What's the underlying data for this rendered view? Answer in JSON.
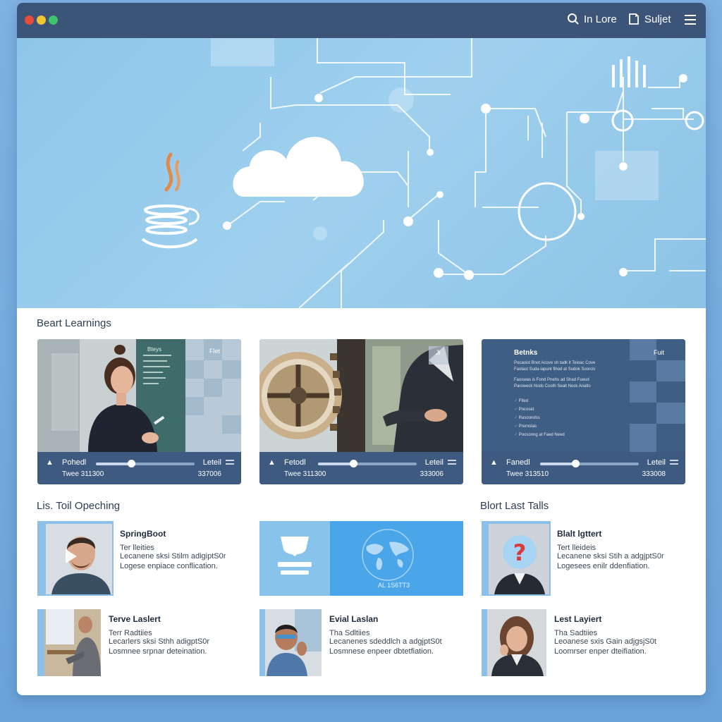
{
  "window": {
    "dots": [
      "close",
      "minimize",
      "maximize"
    ]
  },
  "titlebar": {
    "search_label": "In Lore",
    "subject_label": "Suljet",
    "search_icon": "search-icon",
    "subject_icon": "bookmark-icon",
    "menu_icon": "hamburger-menu-icon"
  },
  "hero": {
    "graphics": [
      "java-logo-icon",
      "cloud-icon",
      "circuit-lines"
    ]
  },
  "sections": {
    "learnings_title": "Beart Learnings",
    "opeching_title": "Lis. Toil Opeching",
    "last_talls_title": "Blort Last Talls"
  },
  "video_cards": [
    {
      "panel_heading": "Bteys",
      "panel_corner": "Flet",
      "control_label": "Pohedl",
      "control_sub": "Twee 311300",
      "level_label": "Leteil",
      "time_label": "337006",
      "progress": 0.36
    },
    {
      "panel_heading": "",
      "panel_corner": "Ji",
      "control_label": "Fetodl",
      "control_sub": "Twee 311300",
      "level_label": "Leteil",
      "time_label": "333006",
      "progress": 0.36
    },
    {
      "panel_heading": "Betnks",
      "panel_corner": "Fuit",
      "panel_lines": [
        "Pocaoist Bnot Acove sh tadk it Teioac Cove",
        "Faotast Suda iapunt fihod at Sudok Soorcis",
        "Faoswas is Fond Pnehs ad Shad Fueud",
        "Paroweck Nods Cooth Sealt Nock Anatlo"
      ],
      "panel_checks": [
        "Flted",
        "Pocoset",
        "Rasoondss",
        "Premolas",
        "Poosonng at Faed Need"
      ],
      "control_label": "Fanedl",
      "control_sub": "Twee 313510",
      "level_label": "Leteil",
      "time_label": "333008",
      "progress": 0.36
    }
  ],
  "courses": [
    {
      "title": "SpringBoot",
      "line1": "Ter lleities",
      "line2": "Lecanene sksi Stilm adigiptS0r",
      "line3": "Logese enpiace conflication."
    },
    {
      "title": "",
      "banner_text": "AL 1S6TT3"
    },
    {
      "title": "Blalt lgttert",
      "line1": "Tert lleideis",
      "line2": "Lecanene sksi Stih a adgjptS0r",
      "line3": "Logesees enilr ddenfiation."
    },
    {
      "title": "Terve Laslert",
      "line1": "Terr Radtiies",
      "line2": "Lecarlers sksi Sthh adigptS0r",
      "line3": "Losmnee srpnar deteination."
    },
    {
      "title": "Evial Laslan",
      "line1": "Tha Sdltiies",
      "line2": "Lecanenes sdeddlch a adgjptS0t",
      "line3": "Losmnese enpeer dbtetfiation."
    },
    {
      "title": "Lest Layiert",
      "line1": "Tha Sadtiies",
      "line2": "Leoanese sxis Gain adjgsjS0t",
      "line3": "Loomrser enper dteifiation."
    }
  ],
  "colors": {
    "titlebar": "#3c5478",
    "hero": "#92c8ea",
    "control_bar": "#3f5a80",
    "accent": "#4aa6e8"
  }
}
